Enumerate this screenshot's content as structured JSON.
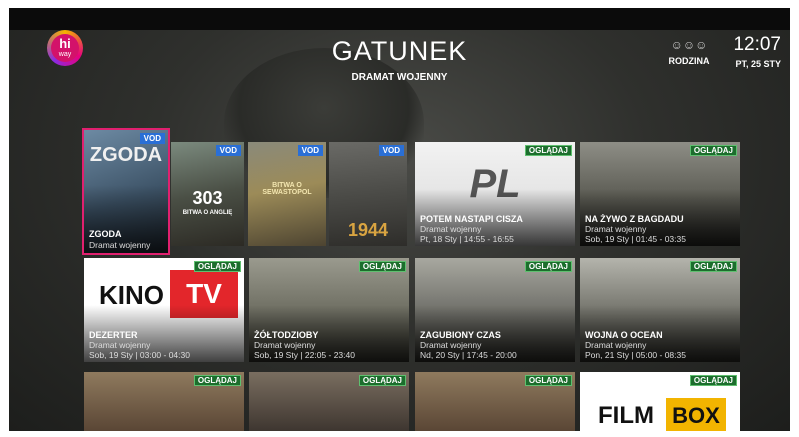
{
  "header": {
    "title": "GATUNEK",
    "subtitle": "DRAMAT WOJENNY",
    "logo_text_top": "hi",
    "logo_text_bottom": "way",
    "profile_label": "RODZINA",
    "clock_time": "12:07",
    "clock_date": "PT, 25 STY"
  },
  "row1": {
    "vod1": {
      "badge": "VOD",
      "poster_text": "ZGODA",
      "name": "ZGODA",
      "genre": "Dramat wojenny"
    },
    "vod2": {
      "badge": "VOD",
      "poster_text": "303",
      "poster_sub": "BITWA O ANGLIĘ"
    },
    "vod3": {
      "badge": "VOD",
      "poster_text": "BITWA O SEWASTOPOL"
    },
    "vod4": {
      "badge": "VOD",
      "poster_text": "1944"
    },
    "live1": {
      "badge": "OGLĄDAJ",
      "logo": "PL",
      "name": "POTEM NASTAPI CISZA",
      "genre": "Dramat wojenny",
      "time": "Pt, 18 Sty | 14:55 - 16:55"
    },
    "live2": {
      "badge": "OGLĄDAJ",
      "name": "NA ŻYWO Z BAGDADU",
      "genre": "Dramat wojenny",
      "time": "Sob, 19 Sty | 01:45 - 03:35"
    }
  },
  "row2": {
    "t1": {
      "badge": "OGLĄDAJ",
      "logo_left": "KINO",
      "logo_right": "TV",
      "name": "DEZERTER",
      "genre": "Dramat wojenny",
      "time": "Sob, 19 Sty | 03:00 - 04:30"
    },
    "t2": {
      "badge": "OGLĄDAJ",
      "name": "ŻÓŁTODZIOBY",
      "genre": "Dramat wojenny",
      "time": "Sob, 19 Sty | 22:05 - 23:40"
    },
    "t3": {
      "badge": "OGLĄDAJ",
      "name": "ZAGUBIONY CZAS",
      "genre": "Dramat wojenny",
      "time": "Nd, 20 Sty | 17:45 - 20:00"
    },
    "t4": {
      "badge": "OGLĄDAJ",
      "name": "WOJNA O OCEAN",
      "genre": "Dramat wojenny",
      "time": "Pon, 21 Sty | 05:00 - 08:35"
    }
  },
  "row3": {
    "t1": {
      "badge": "OGLĄDAJ"
    },
    "t2": {
      "badge": "OGLĄDAJ"
    },
    "t3": {
      "badge": "OGLĄDAJ"
    },
    "t4": {
      "badge": "OGLĄDAJ",
      "logo_left": "FILM",
      "logo_right": "BOX"
    }
  }
}
